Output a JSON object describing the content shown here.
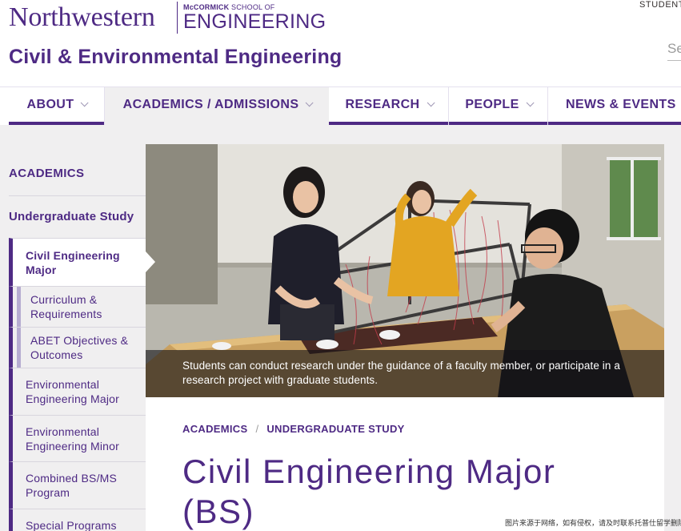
{
  "header": {
    "university": "Northwestern",
    "school_prefix": "McCORMICK",
    "school_mid": "SCHOOL OF",
    "school_name": "ENGINEERING",
    "site_title": "Civil & Environmental Engineering",
    "utility_link": "STUDENT",
    "search_placeholder": "Se"
  },
  "nav": {
    "items": [
      {
        "label": "ABOUT"
      },
      {
        "label": "ACADEMICS / ADMISSIONS"
      },
      {
        "label": "RESEARCH"
      },
      {
        "label": "PEOPLE"
      },
      {
        "label": "NEWS & EVENTS"
      }
    ],
    "active_index": 1
  },
  "sidebar": {
    "heading": "ACADEMICS",
    "items": [
      {
        "label": "Undergraduate Study"
      },
      {
        "label": "Civil Engineering Major"
      },
      {
        "label": "Curriculum & Requirements"
      },
      {
        "label": "ABET Objectives & Outcomes"
      },
      {
        "label": "Environmental Engineering Major"
      },
      {
        "label": "Environmental Engineering Minor"
      },
      {
        "label": "Combined BS/MS Program"
      },
      {
        "label": "Special Programs"
      }
    ]
  },
  "hero": {
    "caption": "Students can conduct research under the guidance of a faculty member, or participate in a research project with graduate students."
  },
  "content": {
    "breadcrumb": [
      "ACADEMICS",
      "UNDERGRADUATE STUDY"
    ],
    "breadcrumb_separator": "/",
    "title": "Civil Engineering Major (BS)"
  },
  "watermark": "图片来源于网络，如有侵权，请及时联系托普仕留学删除",
  "colors": {
    "brand_purple": "#4e2a84",
    "light_purple": "#b6acd1",
    "page_gray": "#f0eff0"
  }
}
